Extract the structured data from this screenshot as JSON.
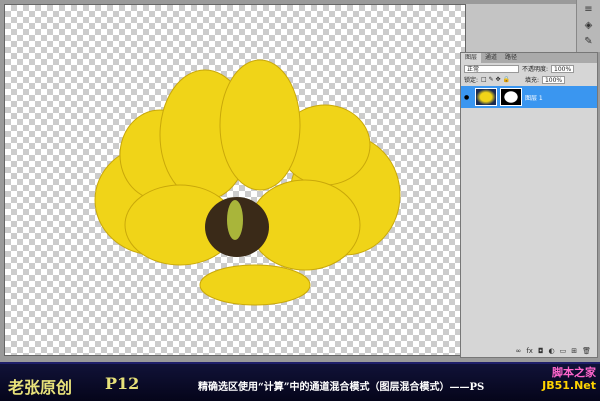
{
  "panel": {
    "tabs": [
      "图层",
      "通道",
      "路径"
    ],
    "blend_mode": "正常",
    "opacity_label": "不透明度:",
    "opacity": "100%",
    "lock_label": "锁定:",
    "fill_label": "填充:",
    "fill": "100%",
    "layer_name": "图层 1"
  },
  "footer": {
    "author": "老张原创",
    "page": "P12",
    "caption": "精确选区使用“计算”中的通道混合模式（图层混合模式）——PS",
    "watermark_cn": "脚本之家",
    "watermark_en": "JB51.Net"
  },
  "colors": {
    "flower": "#f2d619",
    "selection": "#3a96f0"
  }
}
